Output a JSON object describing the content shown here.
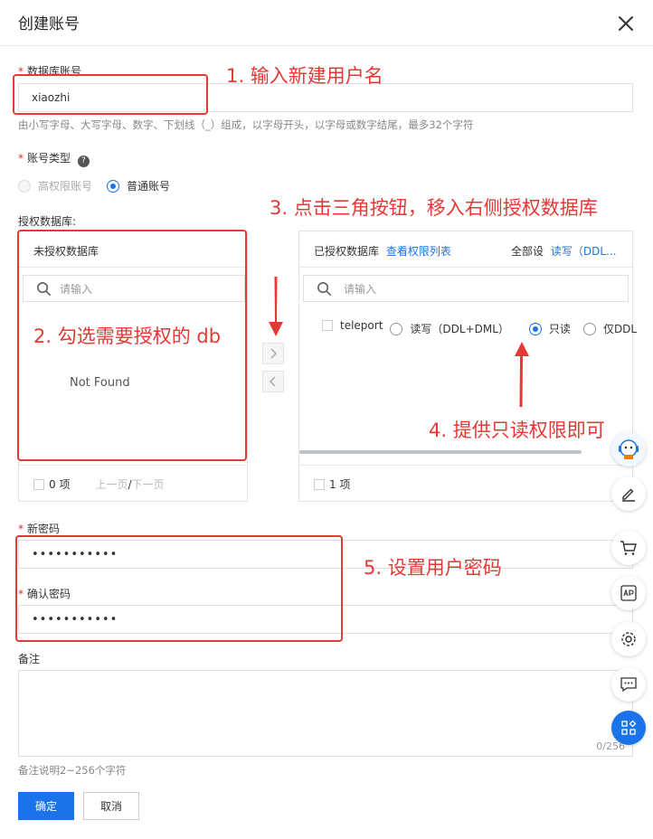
{
  "dialog": {
    "title": "创建账号"
  },
  "account": {
    "label": "数据库账号",
    "value": "xiaozhi",
    "hint": "由小写字母、大写字母、数字、下划线（_）组成，以字母开头，以字母或数字结尾，最多32个字符"
  },
  "account_type": {
    "label": "账号类型",
    "options": [
      "高权限账号",
      "普通账号"
    ]
  },
  "auth": {
    "label": "授权数据库:",
    "left": {
      "header": "未授权数据库",
      "search_placeholder": "请输入",
      "empty": "Not Found",
      "count": "0 项",
      "prev": "上一页",
      "sep": "/",
      "next": "下一页"
    },
    "right": {
      "header": "已授权数据库",
      "view_link": "查看权限列表",
      "all_set": "全部设",
      "all_set_link": "读写（DDL...",
      "search_placeholder": "请输入",
      "db_name": "teleport",
      "perm_options": [
        "读写（DDL+DML）",
        "只读",
        "仅DDL"
      ],
      "count": "1 项"
    }
  },
  "password": {
    "label": "新密码",
    "value": "•••••••••••"
  },
  "confirm_password": {
    "label": "确认密码",
    "value": "•••••••••••"
  },
  "remark": {
    "label": "备注",
    "counter": "0/256",
    "hint": "备注说明2~256个字符"
  },
  "footer": {
    "ok": "确定",
    "cancel": "取消"
  },
  "annotations": {
    "a1": "1. 输入新建用户名",
    "a2": "2. 勾选需要授权的 db",
    "a3": "3. 点击三角按钮，移入右侧授权数据库",
    "a4": "4. 提供只读权限即可",
    "a5": "5. 设置用户密码"
  },
  "colors": {
    "primary": "#1a73e8",
    "annotation": "#e53935"
  }
}
